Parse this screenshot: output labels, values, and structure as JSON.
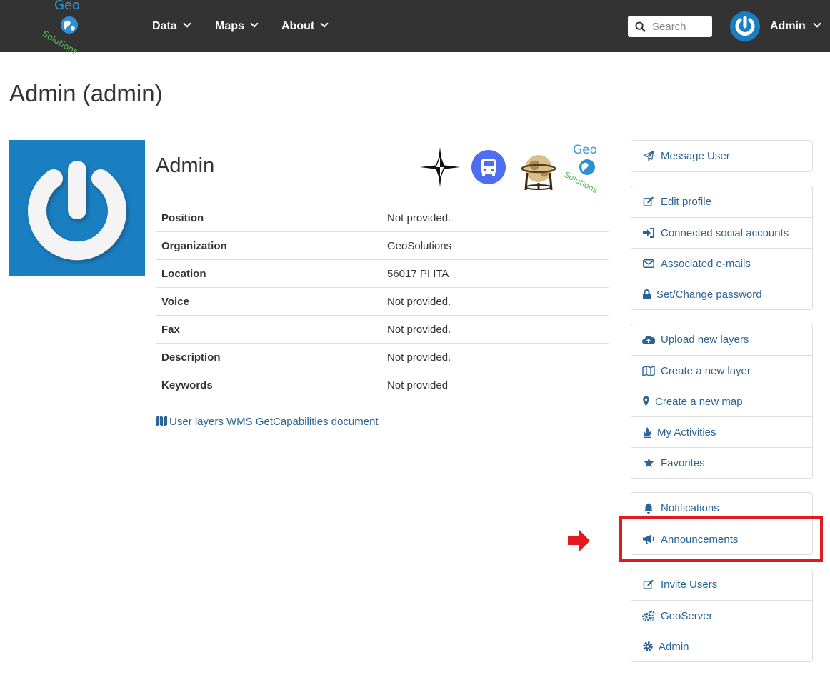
{
  "navbar": {
    "logo_top": "Geo",
    "logo_bottom": "Solutions",
    "menu": [
      {
        "label": "Data"
      },
      {
        "label": "Maps"
      },
      {
        "label": "About"
      }
    ],
    "search_placeholder": "Search",
    "user_label": "Admin",
    "background": "#333333"
  },
  "page": {
    "title": "Admin (admin)"
  },
  "profile": {
    "name": "Admin",
    "badges": [
      "compass-star-icon",
      "bus-icon",
      "globe-icon",
      "geosolutions-logo"
    ],
    "fields": [
      {
        "key": "Position",
        "value": "Not provided."
      },
      {
        "key": "Organization",
        "value": "GeoSolutions"
      },
      {
        "key": "Location",
        "value": "56017 PI ITA"
      },
      {
        "key": "Voice",
        "value": "Not provided."
      },
      {
        "key": "Fax",
        "value": "Not provided."
      },
      {
        "key": "Description",
        "value": "Not provided."
      },
      {
        "key": "Keywords",
        "value": "Not provided"
      }
    ],
    "wms_link": "User layers WMS GetCapabilities document"
  },
  "sidebar": {
    "group1": [
      {
        "label": "Message User",
        "icon": "paper-plane-icon"
      }
    ],
    "group2": [
      {
        "label": "Edit profile",
        "icon": "edit-icon"
      },
      {
        "label": "Connected social accounts",
        "icon": "sign-in-icon"
      },
      {
        "label": "Associated e-mails",
        "icon": "envelope-icon"
      },
      {
        "label": "Set/Change password",
        "icon": "lock-icon"
      }
    ],
    "group3": [
      {
        "label": "Upload new layers",
        "icon": "cloud-upload-icon"
      },
      {
        "label": "Create a new layer",
        "icon": "map-icon"
      },
      {
        "label": "Create a new map",
        "icon": "map-marker-icon"
      },
      {
        "label": "My Activities",
        "icon": "fire-icon"
      },
      {
        "label": "Favorites",
        "icon": "star-icon"
      }
    ],
    "group4": [
      {
        "label": "Notifications",
        "icon": "bell-icon"
      },
      {
        "label": "Announcements",
        "icon": "bullhorn-icon"
      }
    ],
    "group5": [
      {
        "label": "Invite Users",
        "icon": "edit-icon"
      },
      {
        "label": "GeoServer",
        "icon": "cogs-icon"
      },
      {
        "label": "Admin",
        "icon": "cog-icon"
      }
    ]
  },
  "colors": {
    "link": "#2a6496",
    "avatar_blue": "#1a7fc1",
    "highlight_red": "#e3191f"
  }
}
